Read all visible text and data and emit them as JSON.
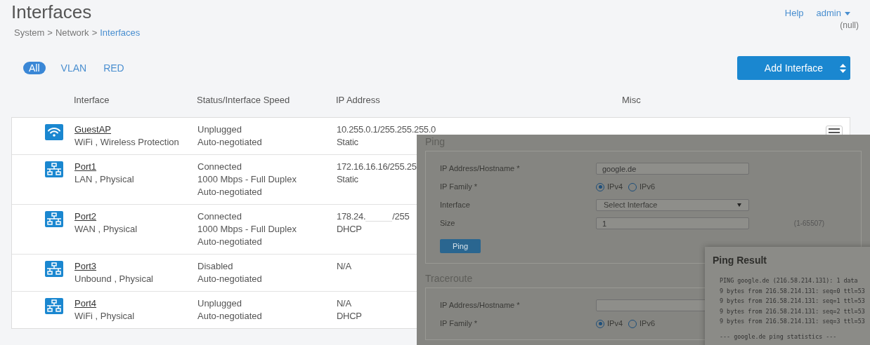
{
  "page": {
    "title": "Interfaces",
    "breadcrumb": [
      {
        "label": "System",
        "current": false
      },
      {
        "label": "Network",
        "current": false
      },
      {
        "label": "Interfaces",
        "current": true
      }
    ],
    "separator": ">"
  },
  "header": {
    "help": "Help",
    "user": "admin",
    "user_note": "(null)"
  },
  "filter_tabs": [
    {
      "label": "All",
      "selected": true
    },
    {
      "label": "VLAN",
      "selected": false
    },
    {
      "label": "RED",
      "selected": false
    }
  ],
  "add_button": "Add Interface",
  "table": {
    "columns": [
      "Interface",
      "Status/Interface Speed",
      "IP Address",
      "Misc"
    ],
    "rows": [
      {
        "kind": "wifi",
        "name": "GuestAP",
        "type": "WiFi , Wireless Protection",
        "status": [
          "Unplugged",
          "Auto-negotiated"
        ],
        "ip": [
          "10.255.0.1/255.255.255.0",
          "Static"
        ],
        "menu": true
      },
      {
        "kind": "wired",
        "name": "Port1",
        "type": "LAN , Physical",
        "status": [
          "Connected",
          "1000 Mbps - Full Duplex",
          "Auto-negotiated"
        ],
        "ip": [
          "172.16.16.16/255.25",
          "Static"
        ]
      },
      {
        "kind": "wired",
        "name": "Port2",
        "type": "WAN , Physical",
        "status": [
          "Connected",
          "1000 Mbps - Full Duplex",
          "Auto-negotiated"
        ],
        "ip": [
          {
            "before": "178.24.",
            "after": "/255"
          },
          "DHCP"
        ]
      },
      {
        "kind": "wired",
        "name": "Port3",
        "type": "Unbound , Physical",
        "status": [
          "Disabled",
          "Auto-negotiated"
        ],
        "ip": [
          "N/A"
        ]
      },
      {
        "kind": "wired",
        "name": "Port4",
        "type": "WiFi , Physical",
        "status": [
          "Unplugged",
          "Auto-negotiated"
        ],
        "ip": [
          "N/A",
          "DHCP"
        ]
      }
    ]
  },
  "overlay": {
    "ping": {
      "title": "Ping",
      "fields": [
        {
          "kind": "input",
          "label": "IP Address/Hostname *",
          "value": "google.de"
        },
        {
          "kind": "radio",
          "label": "IP Family *",
          "options": [
            {
              "label": "IPv4",
              "selected": true
            },
            {
              "label": "IPv6",
              "selected": false
            }
          ]
        },
        {
          "kind": "select",
          "label": "Interface",
          "value": "Select Interface"
        },
        {
          "kind": "input",
          "label": "Size",
          "value": "1",
          "hint": "(1-65507)"
        }
      ],
      "button": "Ping"
    },
    "traceroute": {
      "title": "Traceroute",
      "fields": [
        {
          "kind": "input",
          "label": "IP Address/Hostname *"
        },
        {
          "kind": "radio",
          "label": "IP Family *",
          "options": [
            {
              "label": "IPv4",
              "selected": true
            },
            {
              "label": "IPv6",
              "selected": false
            }
          ]
        }
      ]
    },
    "result": {
      "title": "Ping Result",
      "lines": [
        "PING google.de (216.58.214.131): 1 data",
        "9 bytes from 216.58.214.131: seq=0 ttl=53",
        "9 bytes from 216.58.214.131: seq=1 ttl=53",
        "9 bytes from 216.58.214.131: seq=2 ttl=53",
        "9 bytes from 216.58.214.131: seq=3 ttl=53"
      ],
      "summary": "--- google.de ping statistics ---"
    }
  }
}
